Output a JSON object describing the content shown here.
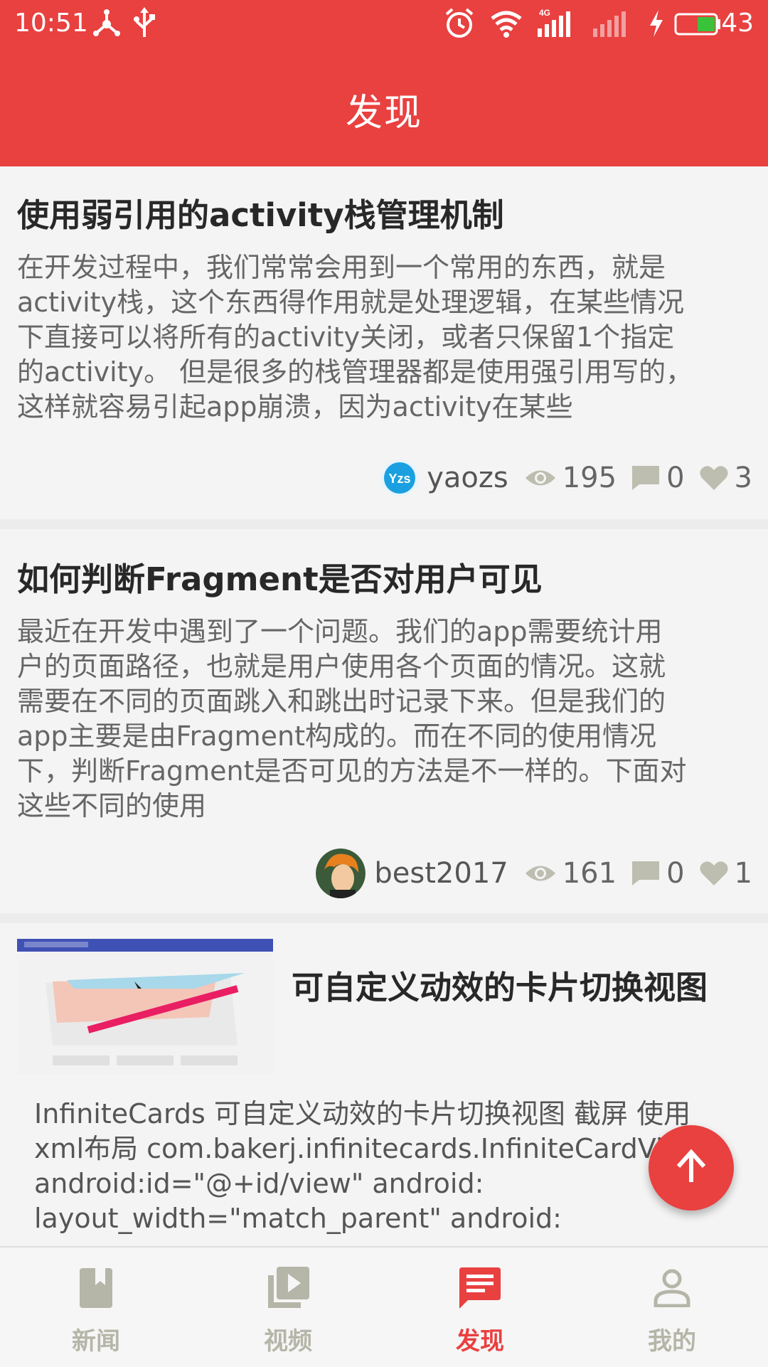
{
  "status_bar": {
    "time": "10:51",
    "network": "4G",
    "battery_percent": "43",
    "icons": [
      "share-icon",
      "usb-icon",
      "alarm-icon",
      "wifi-icon",
      "signal-icon",
      "signal-empty-icon",
      "charging-icon",
      "battery-icon"
    ]
  },
  "app_bar": {
    "title": "发现"
  },
  "articles": [
    {
      "title": "使用弱引用的activity栈管理机制",
      "body": "在开发过程中，我们常常会用到一个常用的东西，就是\nactivity栈，这个东西得作用就是处理逻辑，在某些情况\n下直接可以将所有的activity关闭，或者只保留1个指定\n的activity。 但是很多的栈管理器都是使用强引用写的，\n这样就容易引起app崩溃，因为activity在某些",
      "author": "yaozs",
      "avatar_text": "Yzs",
      "views": "195",
      "comments": "0",
      "likes": "3"
    },
    {
      "title": "如何判断Fragment是否对用户可见",
      "body": "最近在开发中遇到了一个问题。我们的app需要统计用\n户的页面路径，也就是用户使用各个页面的情况。这就\n需要在不同的页面跳入和跳出时记录下来。但是我们的\napp主要是由Fragment构成的。而在不同的使用情况\n下，判断Fragment是否可见的方法是不一样的。下面对\n这些不同的使用",
      "author": "best2017",
      "views": "161",
      "comments": "0",
      "likes": "1"
    },
    {
      "title": "可自定义动效的卡片切换视图",
      "body": "InfiniteCards 可自定义动效的卡片切换视图 截屏 使用\nxml布局 com.bakerj.infinitecards.InfiniteCardView\nandroid:id=\"@+id/view\" android:\nlayout_width=\"match_parent\" android:"
    }
  ],
  "fab": {
    "icon": "arrow-up-icon"
  },
  "bottom_nav": {
    "items": [
      {
        "label": "新闻",
        "icon": "book-icon",
        "active": false
      },
      {
        "label": "视频",
        "icon": "video-library-icon",
        "active": false
      },
      {
        "label": "发现",
        "icon": "chat-icon",
        "active": true
      },
      {
        "label": "我的",
        "icon": "person-icon",
        "active": false
      }
    ]
  },
  "colors": {
    "primary": "#e94040",
    "inactive": "#b5b5a8",
    "background": "#f4f4f4"
  }
}
